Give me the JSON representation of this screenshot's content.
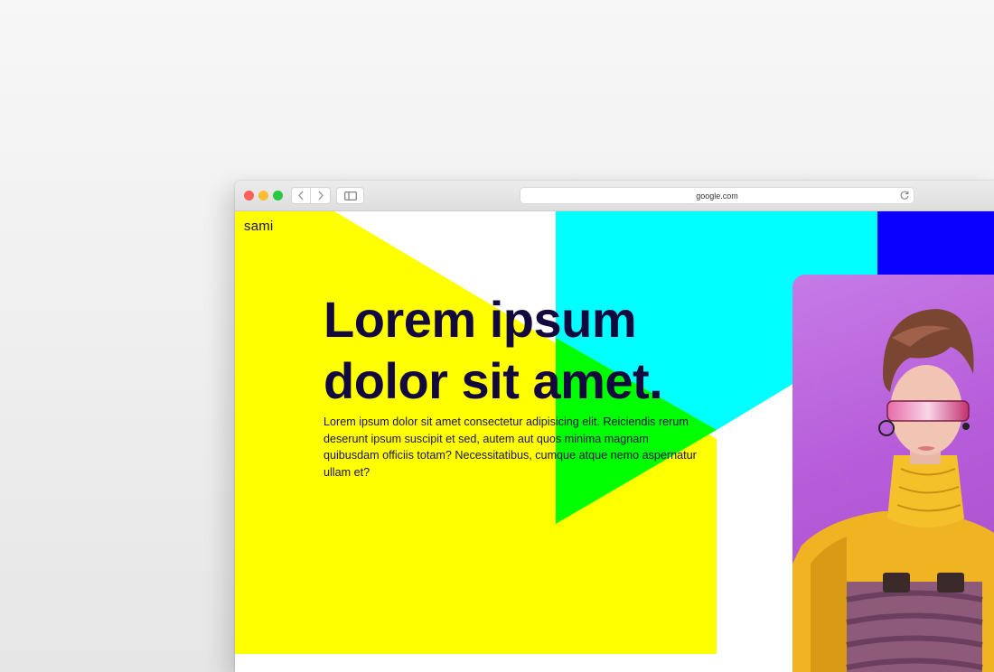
{
  "browser": {
    "url": "google.com",
    "back_icon": "chevron-left-icon",
    "forward_icon": "chevron-right-icon",
    "sidebar_icon": "sidebar-icon",
    "reload_icon": "reload-icon"
  },
  "site": {
    "logo": "sami",
    "headline_line1": "Lorem ipsum",
    "headline_line2": "dolor sit amet.",
    "body": "Lorem ipsum dolor sit amet consectetur adipisicing elit. Reiciendis rerum deserunt ipsum suscipit et sed, autem aut quos minima magnam quibusdam officiis totam? Necessitatibus, cumque atque nemo aspernatur ullam et?",
    "hero_image_alt": "illustration of a person with visor glasses and yellow turtleneck"
  },
  "colors": {
    "yellow": "#ffff00",
    "cyan": "#00ffff",
    "green": "#00ff00",
    "blue": "#0a00ff",
    "purple": "#c06be3",
    "text_dark": "#14093f"
  }
}
